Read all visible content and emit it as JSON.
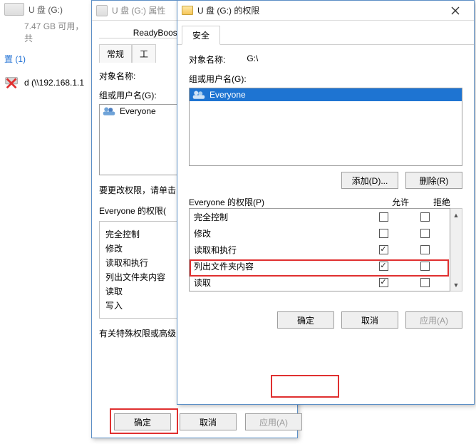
{
  "explorer": {
    "drive_label": "U 盘 (G:)",
    "freespace": "7.47 GB 可用，共",
    "count": "置 (1)",
    "network_item": "d (\\\\192.168.1.1"
  },
  "properties": {
    "title": "U 盘 (G:) 属性",
    "tab_readyboost": "ReadyBoost",
    "tab_general": "常规",
    "tab_tools": "工",
    "object_name_label": "对象名称:",
    "group_users_label": "组或用户名(G):",
    "group_items": [
      "Everyone"
    ],
    "change_hint": "要更改权限，请单击",
    "perm_header": "Everyone 的权限(",
    "perm_rows": [
      "完全控制",
      "修改",
      "读取和执行",
      "列出文件夹内容",
      "读取",
      "写入"
    ],
    "special_hint": "有关特殊权限或高级",
    "btn_ok": "确定",
    "btn_cancel": "取消",
    "btn_apply": "应用(A)"
  },
  "permissions": {
    "title": "U 盘 (G:) 的权限",
    "tab_security": "安全",
    "object_name_label": "对象名称:",
    "object_name_value": "G:\\",
    "group_users_label": "组或用户名(G):",
    "group_items": [
      "Everyone"
    ],
    "btn_add": "添加(D)...",
    "btn_remove": "删除(R)",
    "perm_header": "Everyone 的权限(P)",
    "col_allow": "允许",
    "col_deny": "拒绝",
    "perm_rows": [
      {
        "name": "完全控制",
        "allow": false,
        "deny": false
      },
      {
        "name": "修改",
        "allow": false,
        "deny": false
      },
      {
        "name": "读取和执行",
        "allow": true,
        "deny": false
      },
      {
        "name": "列出文件夹内容",
        "allow": true,
        "deny": false
      },
      {
        "name": "读取",
        "allow": true,
        "deny": false
      }
    ],
    "btn_ok": "确定",
    "btn_cancel": "取消",
    "btn_apply": "应用(A)"
  }
}
